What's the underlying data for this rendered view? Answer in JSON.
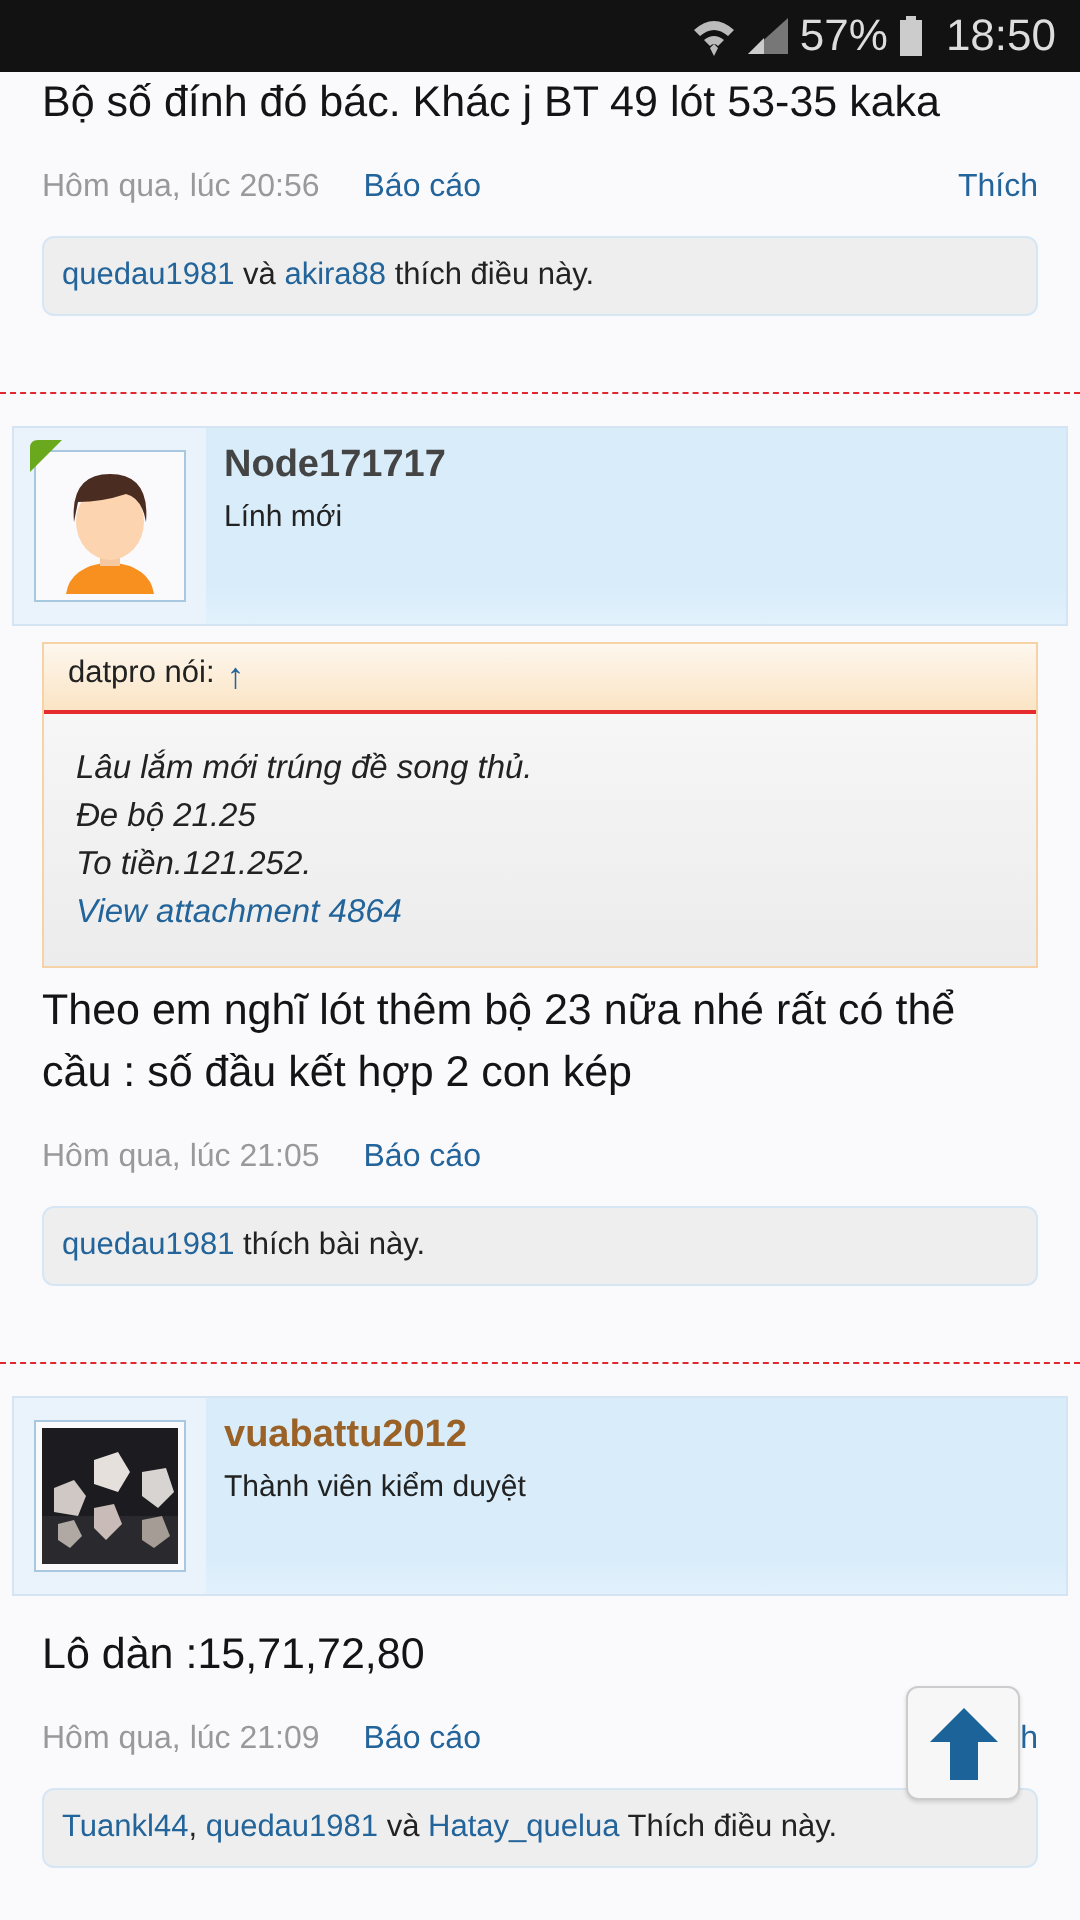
{
  "status_bar": {
    "battery": "57%",
    "time": "18:50"
  },
  "posts": [
    {
      "message": "Bộ số đính đó bác. Khác j BT 49 lót 53-35 kaka",
      "date": "Hôm qua, lúc 20:56",
      "report": "Báo cáo",
      "like": "Thích",
      "likes": [
        {
          "kind": "user",
          "text": "quedau1981"
        },
        {
          "kind": "text",
          "text": " và "
        },
        {
          "kind": "user",
          "text": "akira88"
        },
        {
          "kind": "text",
          "text": " thích điều này."
        }
      ]
    },
    {
      "author": {
        "name": "Node171717",
        "title": "Lính mới",
        "color": "#444444",
        "online": true,
        "avatar": {
          "kind": "figure"
        }
      },
      "quote": {
        "author": "datpro nói:",
        "jump": "↑",
        "lines": [
          "Lâu lắm mới trúng đề song thủ.",
          "Đe bộ 21.25",
          "To tiền.121.252."
        ],
        "attachment": "View attachment 4864"
      },
      "message": "Theo em nghĩ lót thêm bộ 23 nữa nhé rất có thể cầu : số đầu kết hợp 2 con kép",
      "date": "Hôm qua, lúc 21:05",
      "report": "Báo cáo",
      "likes": [
        {
          "kind": "user",
          "text": "quedau1981"
        },
        {
          "kind": "text",
          "text": " thích bài này."
        }
      ]
    },
    {
      "author": {
        "name": "vuabattu2012",
        "title": "Thành viên kiểm duyệt",
        "color": "#9a6226",
        "online": false
      },
      "message": "Lô dàn :15,71,72,80",
      "date": "Hôm qua, lúc 21:09",
      "report": "Báo cáo",
      "like": "h",
      "likes": [
        {
          "kind": "user",
          "text": "Tuankl44",
          "separator": ", "
        },
        {
          "kind": "user",
          "text": "quedau1981"
        },
        {
          "kind": "text",
          "text": " và "
        },
        {
          "kind": "user",
          "text": "Hatay_quelua"
        },
        {
          "kind": "text",
          "text": " Thích điều này."
        }
      ]
    }
  ]
}
